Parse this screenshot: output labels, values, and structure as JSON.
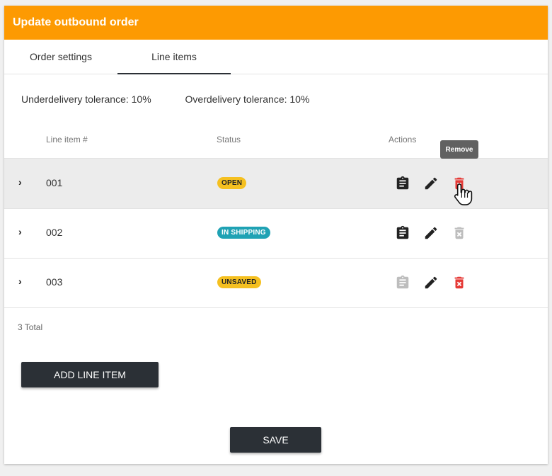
{
  "header": {
    "title": "Update outbound order"
  },
  "tabs": [
    {
      "label": "Order settings",
      "active": false
    },
    {
      "label": "Line items",
      "active": true
    }
  ],
  "tolerances": {
    "under": "Underdelivery tolerance: 10%",
    "over": "Overdelivery tolerance: 10%"
  },
  "table": {
    "columns": [
      "Line item #",
      "Status",
      "Actions"
    ],
    "rows": [
      {
        "number": "001",
        "status": "OPEN",
        "status_color": "#f5c020",
        "copy_enabled": true,
        "remove_enabled": true
      },
      {
        "number": "002",
        "status": "IN SHIPPING",
        "status_color": "#1fa2b4",
        "copy_enabled": true,
        "remove_enabled": false
      },
      {
        "number": "003",
        "status": "UNSAVED",
        "status_color": "#f5c020",
        "copy_enabled": false,
        "remove_enabled": true
      }
    ],
    "total": "3 Total"
  },
  "tooltip": {
    "text": "Remove"
  },
  "buttons": {
    "add": "ADD LINE ITEM",
    "save": "SAVE"
  },
  "icons": {
    "expand": "chevron-right-icon",
    "copy": "clipboard-icon",
    "edit": "pencil-icon",
    "remove": "trash-icon"
  },
  "colors": {
    "header": "#fd9a02",
    "dark_button": "#2b3036",
    "remove_red": "#e53935",
    "disabled_gray": "#bdbdbd"
  }
}
